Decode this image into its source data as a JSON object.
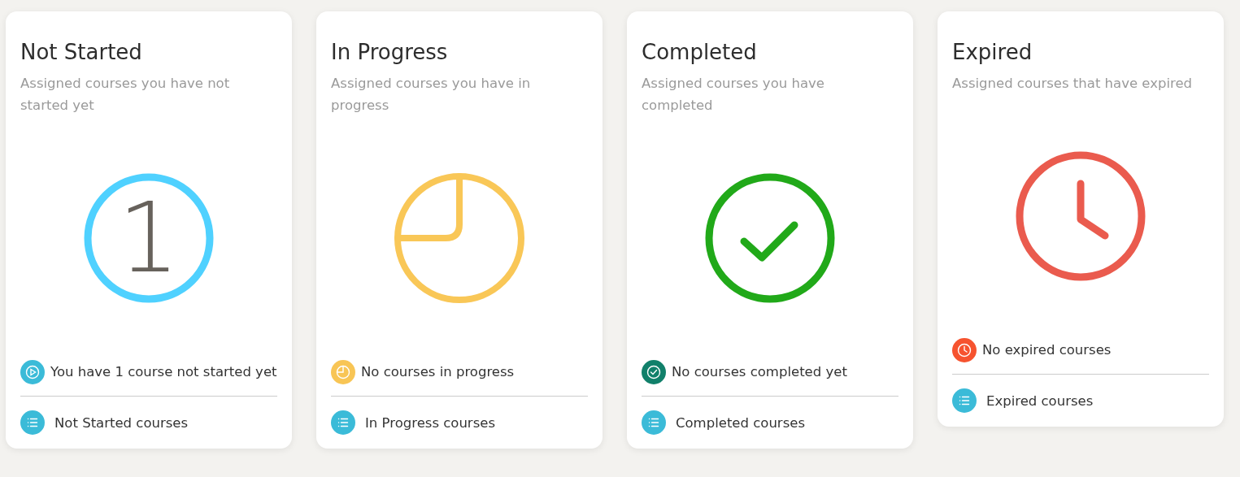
{
  "cards": [
    {
      "title": "Not Started",
      "description": "Assigned courses you have not started yet",
      "graphic": {
        "kind": "count",
        "color": "#4fd1ff",
        "count": "1"
      },
      "status": {
        "kind": "play",
        "color": "#3bbbd8",
        "text": "You have 1 course not started yet"
      },
      "link": "Not Started courses"
    },
    {
      "title": "In Progress",
      "description": "Assigned courses you have in progress",
      "graphic": {
        "kind": "pie",
        "color": "#f9c757"
      },
      "status": {
        "kind": "pie",
        "color": "#f8c555",
        "text": "No courses in progress"
      },
      "link": "In Progress courses"
    },
    {
      "title": "Completed",
      "description": "Assigned courses you have completed",
      "graphic": {
        "kind": "check",
        "color": "#21a919"
      },
      "status": {
        "kind": "check",
        "color": "#11806a",
        "text": "No courses completed yet"
      },
      "link": "Completed courses"
    },
    {
      "title": "Expired",
      "description": "Assigned courses that have expired",
      "graphic": {
        "kind": "clock",
        "color": "#ea5b4e"
      },
      "status": {
        "kind": "clock",
        "color": "#f6532f",
        "text": "No expired courses"
      },
      "link": "Expired courses"
    }
  ]
}
